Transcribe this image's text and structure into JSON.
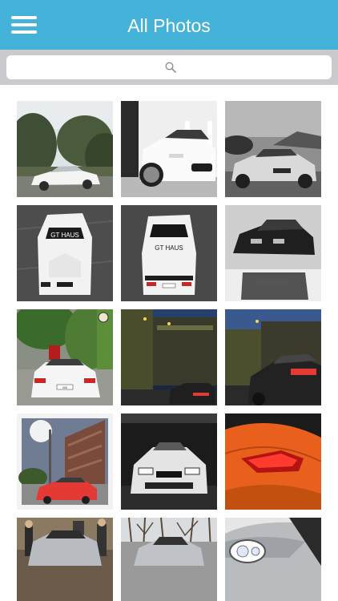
{
  "header": {
    "title": "All Photos",
    "menu_icon": "hamburger-menu-icon"
  },
  "search": {
    "placeholder": "",
    "icon": "search-icon"
  },
  "colors": {
    "nav_bar": "#45b2d9",
    "search_bar": "#c9c9ce"
  },
  "photos": [
    {
      "subject": "white-coupe-on-forest-road"
    },
    {
      "subject": "white-coupe-front-grille-garage"
    },
    {
      "subject": "white-coupe-mountain-road"
    },
    {
      "subject": "white-widebody-top-view-gt-haus"
    },
    {
      "subject": "white-widebody-rear-top-view-gt-haus"
    },
    {
      "subject": "black-coupe-black-and-white"
    },
    {
      "subject": "white-coupe-rear-city-street"
    },
    {
      "subject": "red-car-night-tunnel"
    },
    {
      "subject": "dark-coupe-night-tunnel"
    },
    {
      "subject": "red-coupe-industrial-building"
    },
    {
      "subject": "black-coupe-studio-front"
    },
    {
      "subject": "orange-coupe-taillight-closeup"
    },
    {
      "subject": "silver-coupe-with-people"
    },
    {
      "subject": "silver-coupe-bare-trees"
    },
    {
      "subject": "silver-coupe-headlight-closeup"
    }
  ],
  "photo_badges": {
    "gt_haus_logo": "GT HAUS",
    "plate_text": "M3"
  }
}
